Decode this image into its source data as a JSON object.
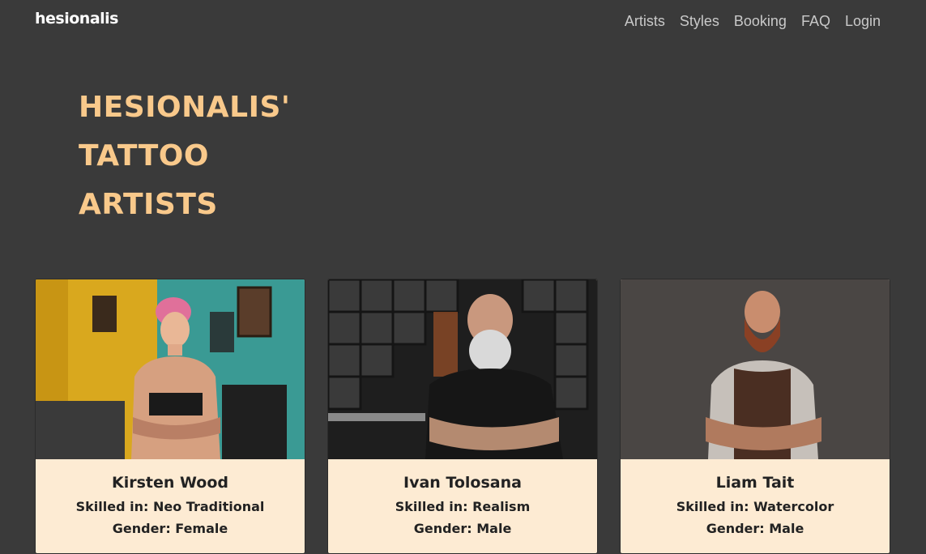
{
  "nav": {
    "brand": "hesionalis",
    "links": [
      "Artists",
      "Styles",
      "Booking",
      "FAQ",
      "Login"
    ]
  },
  "hero": {
    "title_lines": [
      "HESIONALIS'",
      "TATTOO",
      "ARTISTS"
    ]
  },
  "artists": [
    {
      "name": "Kirsten Wood",
      "skill": "Skilled in: Neo Traditional",
      "gender": "Gender: Female"
    },
    {
      "name": "Ivan Tolosana",
      "skill": "Skilled in: Realism",
      "gender": "Gender: Male"
    },
    {
      "name": "Liam Tait",
      "skill": "Skilled in: Watercolor",
      "gender": "Gender: Male"
    }
  ],
  "colors": {
    "background": "#3a3a3a",
    "accent": "#f9c98b",
    "card": "#fdebd3"
  }
}
